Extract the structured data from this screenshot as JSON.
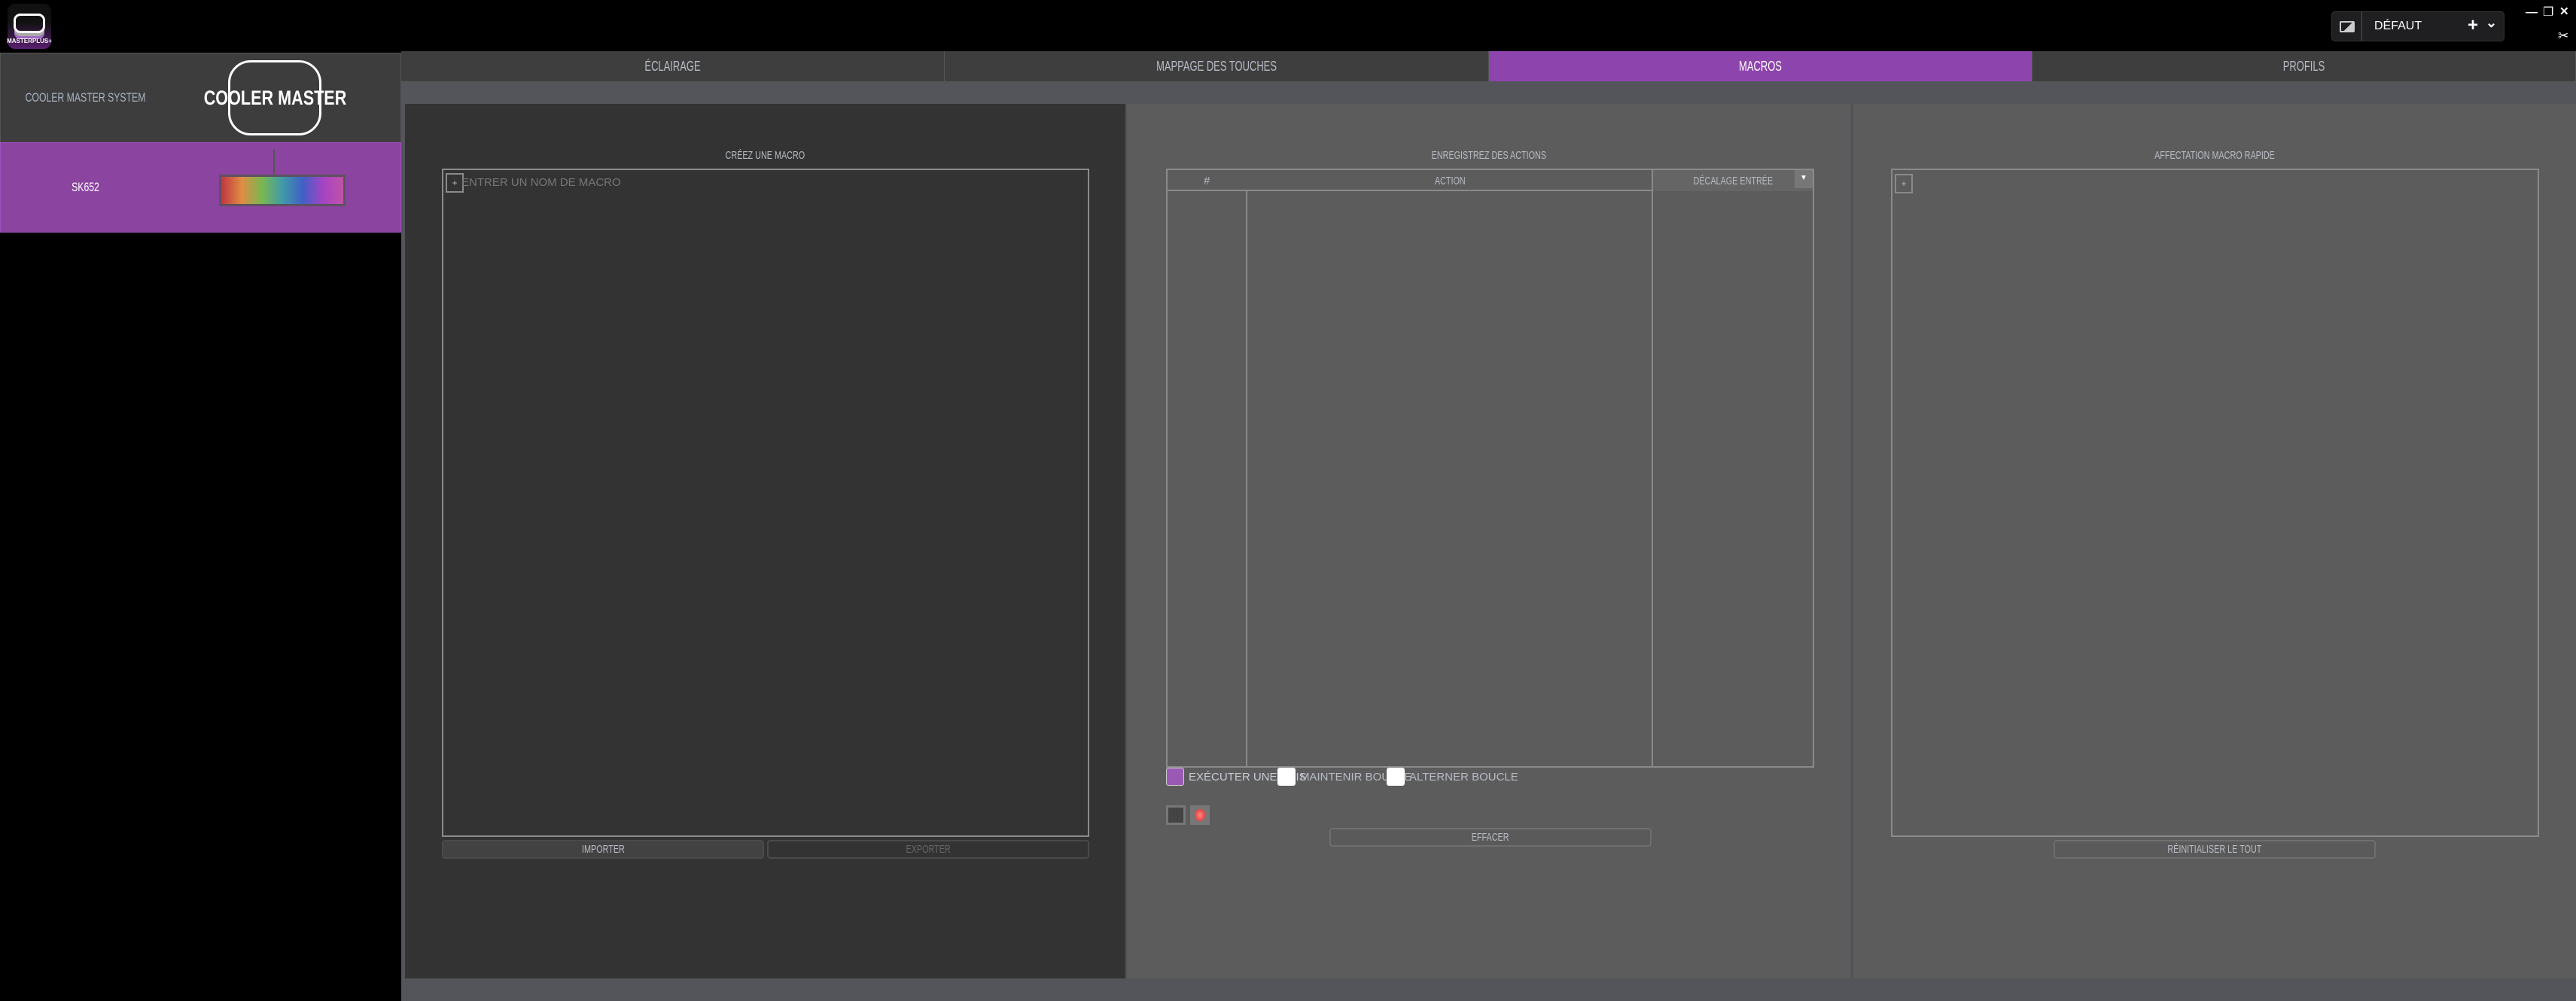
{
  "app": {
    "logo_text": "MASTERPLUS+"
  },
  "profile": {
    "name": "DÉFAUT",
    "icon": "image-icon",
    "add": "+",
    "dropdown": "⌄"
  },
  "window": {
    "minimize": "—",
    "restore": "❐",
    "close": "✕",
    "tools": "✂"
  },
  "sidebar": {
    "items": [
      {
        "label": "COOLER MASTER SYSTEM",
        "logo": "COOLER MASTER"
      },
      {
        "label": "SK652",
        "active": true
      }
    ]
  },
  "tabs": [
    {
      "label": "ÉCLAIRAGE"
    },
    {
      "label": "MAPPAGE DES TOUCHES"
    },
    {
      "label": "MACROS",
      "active": true
    },
    {
      "label": "PROFILS"
    }
  ],
  "create_macro": {
    "title": "CRÉEZ UNE MACRO",
    "add": "+",
    "placeholder": "ENTRER UN NOM DE MACRO",
    "import": "IMPORTER",
    "export": "EXPORTER"
  },
  "record": {
    "title": "ENREGISTREZ DES ACTIONS",
    "columns": [
      "#",
      "ACTION",
      "DÉCALAGE ENTRÉE"
    ],
    "options": [
      {
        "label": "EXÉCUTER UNE FOIS",
        "checked": true
      },
      {
        "label": "MAINTENIR BOUCLE",
        "checked": false
      },
      {
        "label": "ALTERNER BOUCLE",
        "checked": false
      }
    ],
    "clear": "EFFACER"
  },
  "quick": {
    "title": "AFFECTATION MACRO RAPIDE",
    "add": "+",
    "reset": "RÉINITIALISER LE TOUT"
  },
  "colors": {
    "accent": "#8e44ad"
  }
}
